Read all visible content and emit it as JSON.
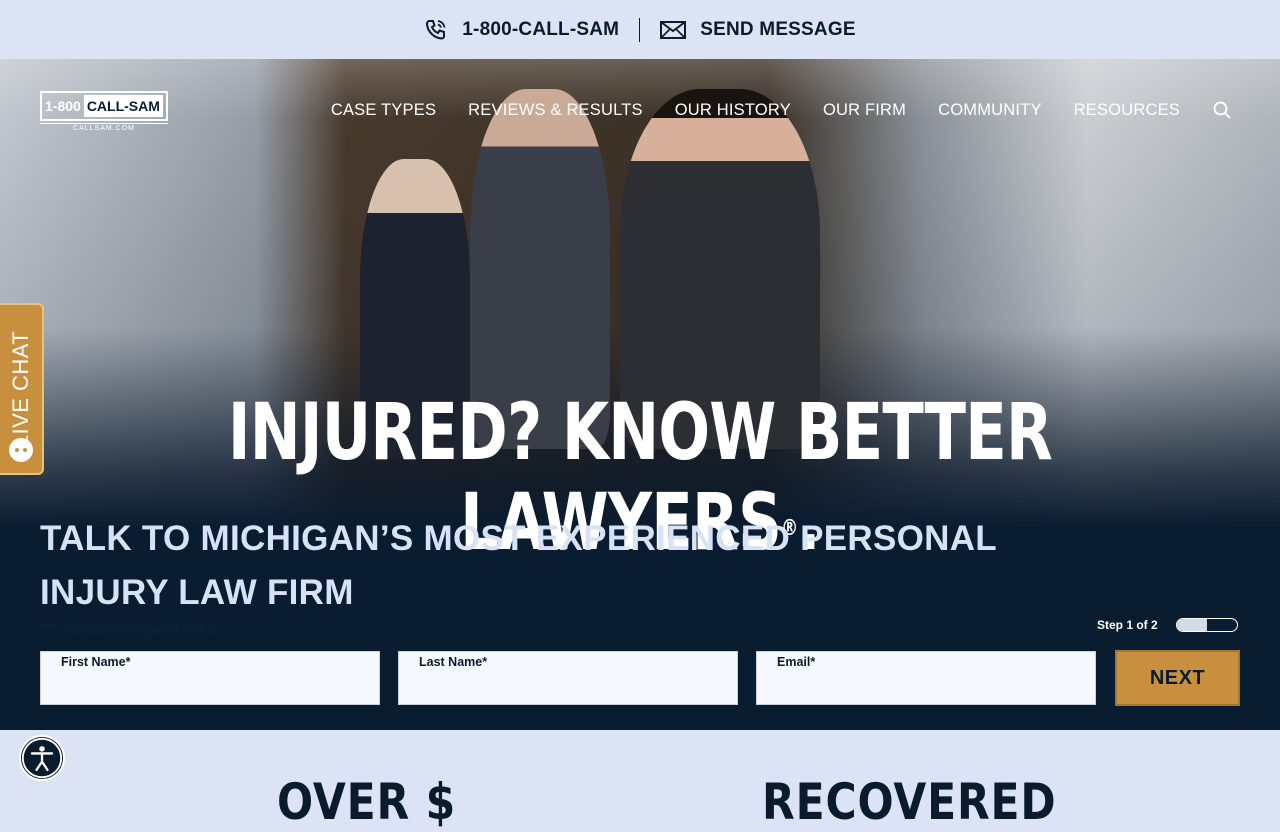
{
  "topbar": {
    "phone_icon": "phone-icon",
    "phone_label": "1-800-CALL-SAM",
    "message_icon": "envelope-icon",
    "message_label": "SEND MESSAGE"
  },
  "logo": {
    "left": "1-800",
    "right": "CALL-SAM",
    "sub": "CALLSAM.COM"
  },
  "nav": {
    "items": [
      "CASE TYPES",
      "REVIEWS & RESULTS",
      "OUR HISTORY",
      "OUR FIRM",
      "COMMUNITY",
      "RESOURCES"
    ],
    "search_icon": "search-icon"
  },
  "live_chat": {
    "label": "LIVE CHAT",
    "icon": "chat-bubble-icon"
  },
  "hero": {
    "headline": "INJURED? KNOW BETTER LAWYERS",
    "headline_mark": "®",
    "headline_end": ".",
    "subhead": "TALK TO MICHIGAN’S MOST EXPERIENCED PERSONAL INJURY LAW FIRM"
  },
  "form": {
    "required_note": "\"*\" indicates required fields",
    "step_label": "Step 1 of 2",
    "progress_fraction": 0.5,
    "fields": [
      {
        "label": "First Name*",
        "value": ""
      },
      {
        "label": "Last Name*",
        "value": ""
      },
      {
        "label": "Email*",
        "value": ""
      }
    ],
    "next_label": "NEXT"
  },
  "accessibility": {
    "icon": "accessibility-icon"
  },
  "stats": {
    "left": "OVER $",
    "right": "RECOVERED"
  },
  "colors": {
    "accent": "#c8903e",
    "navy": "#0a1c30",
    "light": "#dbe3f5"
  }
}
